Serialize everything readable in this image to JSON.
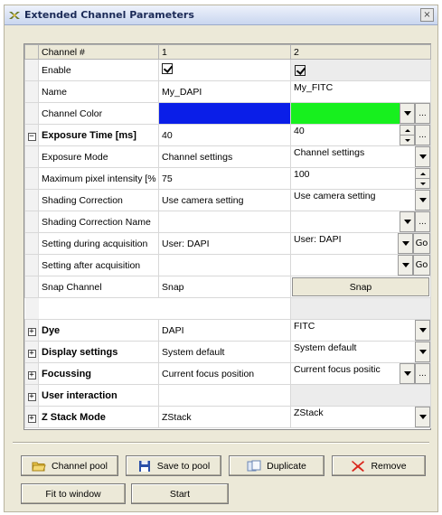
{
  "window": {
    "title": "Extended Channel Parameters",
    "close_glyph": "×"
  },
  "grid": {
    "header": {
      "label": "Channel #",
      "col1": "1",
      "col2": "2"
    },
    "rows": {
      "enable": {
        "label": "Enable",
        "v1_checked": true,
        "v2_checked": true
      },
      "name": {
        "label": "Name",
        "v1": "My_DAPI",
        "v2": "My_FITC"
      },
      "color": {
        "label": "Channel Color",
        "v1_color": "#0a1ee8",
        "v2_color": "#17f01e"
      },
      "exposure": {
        "label": "Exposure Time [ms]",
        "v1": "40",
        "v2": "40",
        "expander": "⊟"
      },
      "mode": {
        "label": "Exposure Mode",
        "v1": "Channel settings",
        "v2": "Channel settings"
      },
      "maxpix": {
        "label": "Maximum pixel intensity [%",
        "v1": "75",
        "v2": "100"
      },
      "shading": {
        "label": "Shading Correction",
        "v1": "Use camera setting",
        "v2": "Use camera setting"
      },
      "shading_name": {
        "label": "Shading Correction Name",
        "v1": "",
        "v2": ""
      },
      "during": {
        "label": "Setting during acquisition",
        "v1": "User: DAPI",
        "v2": "User: DAPI",
        "go": "Go"
      },
      "after": {
        "label": "Setting after acquisition",
        "v1": "",
        "v2": "",
        "go": "Go"
      },
      "snap": {
        "label": "Snap Channel",
        "v1": "Snap",
        "v2": "Snap"
      },
      "dye": {
        "label": "Dye",
        "v1": "DAPI",
        "v2": "FITC",
        "expander": "⊞"
      },
      "display": {
        "label": "Display settings",
        "v1": "System default",
        "v2": "System default",
        "expander": "⊞"
      },
      "focus": {
        "label": "Focussing",
        "v1": "Current focus position",
        "v2": "Current focus positic",
        "expander": "⊞"
      },
      "user": {
        "label": "User interaction",
        "expander": "⊞"
      },
      "zstack": {
        "label": "Z Stack Mode",
        "v1": "ZStack",
        "v2": "ZStack",
        "expander": "⊞"
      }
    },
    "ellipsis": "..."
  },
  "buttons": {
    "channel_pool": "Channel pool",
    "save_to_pool": "Save to pool",
    "duplicate": "Duplicate",
    "remove": "Remove",
    "fit_to_window": "Fit to window",
    "start": "Start"
  },
  "icons": {
    "title": "app-logo-icon",
    "channel_pool": "folder-icon",
    "save_to_pool": "floppy-disk-icon",
    "duplicate": "copy-icon",
    "remove": "red-x-icon"
  }
}
